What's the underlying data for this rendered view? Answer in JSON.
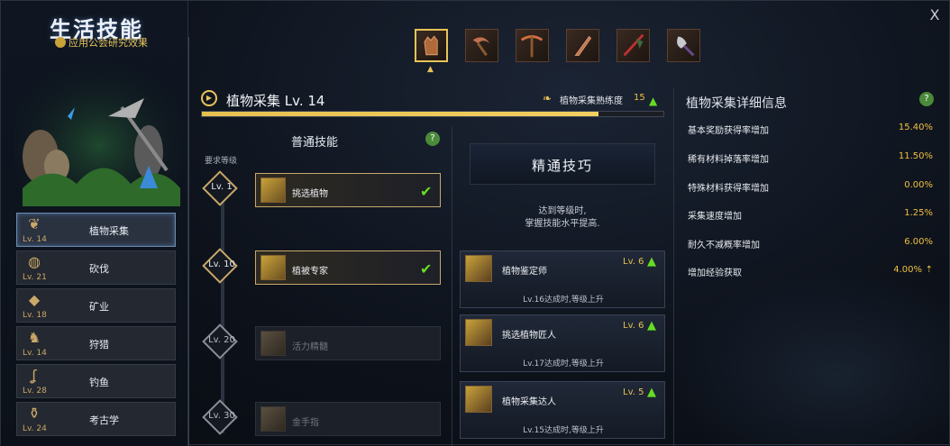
{
  "window": {
    "close_label": "X"
  },
  "left": {
    "title": "生活技能",
    "subtitle": "应用公会研究效果",
    "skills": [
      {
        "name": "植物采集",
        "level": "Lv. 14",
        "icon": "sprout-icon",
        "selected": true
      },
      {
        "name": "砍伐",
        "level": "Lv. 21",
        "icon": "log-icon"
      },
      {
        "name": "矿业",
        "level": "Lv. 18",
        "icon": "ore-icon"
      },
      {
        "name": "狩猎",
        "level": "Lv. 14",
        "icon": "hunt-icon"
      },
      {
        "name": "钓鱼",
        "level": "Lv. 28",
        "icon": "hook-icon"
      },
      {
        "name": "考古学",
        "level": "Lv. 24",
        "icon": "shovel-icon"
      }
    ]
  },
  "tools": [
    "glove-icon",
    "sickle-icon",
    "pickaxe-icon",
    "knife-icon",
    "rod-icon",
    "shovel-icon"
  ],
  "header": {
    "skill_title": "植物采集 Lv. 14",
    "proficiency_label": "植物采集熟练度",
    "proficiency_value": "15",
    "progress": 0.86
  },
  "normal": {
    "title": "普通技能",
    "req_label": "要求等级",
    "help": "?",
    "rows": [
      {
        "level": "Lv. 1",
        "name": "挑选植物",
        "unlocked": true
      },
      {
        "level": "Lv. 10",
        "name": "植被专家",
        "unlocked": true
      },
      {
        "level": "Lv. 20",
        "name": "活力精髓",
        "unlocked": false
      },
      {
        "level": "Lv. 30",
        "name": "金手指",
        "unlocked": false
      }
    ]
  },
  "mastery": {
    "title": "精通技巧",
    "desc1": "达到等级时,",
    "desc2": "掌握技能水平提高.",
    "cards": [
      {
        "name": "植物鉴定师",
        "level": "Lv. 6",
        "sub": "Lv.16达成时,等级上升"
      },
      {
        "name": "挑选植物匠人",
        "level": "Lv. 6",
        "sub": "Lv.17达成时,等级上升"
      },
      {
        "name": "植物采集达人",
        "level": "Lv. 5",
        "sub": "Lv.15达成时,等级上升"
      }
    ]
  },
  "details": {
    "title": "植物采集详细信息",
    "help": "?",
    "rows": [
      {
        "label": "基本奖励获得率增加",
        "value": "15.40%"
      },
      {
        "label": "稀有材料掉落率增加",
        "value": "11.50%"
      },
      {
        "label": "特殊材料获得率增加",
        "value": "0.00%"
      },
      {
        "label": "采集速度增加",
        "value": "1.25%"
      },
      {
        "label": "耐久不减概率增加",
        "value": "6.00%"
      },
      {
        "label": "增加经验获取",
        "value": "4.00%"
      }
    ]
  }
}
